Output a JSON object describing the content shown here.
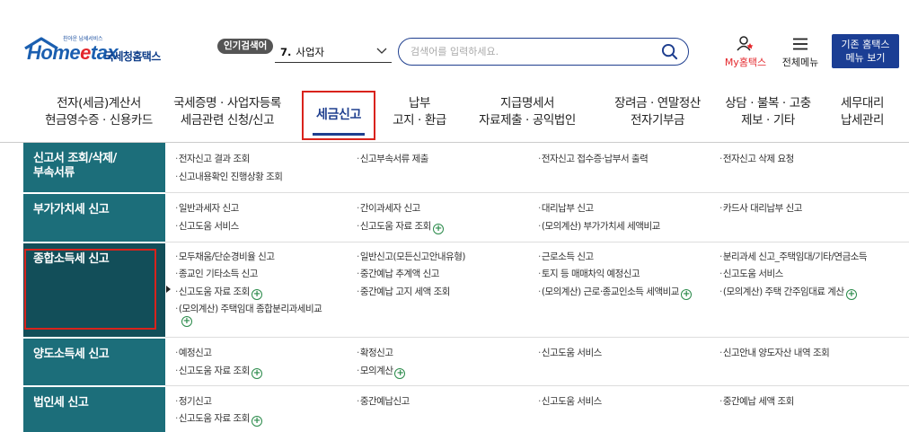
{
  "logo": {
    "tagline": "친아운 납세서비스",
    "home": "Home",
    "tax": "tax",
    "nts_name": "국세청홈택스"
  },
  "popular_search": {
    "badge": "인기검색어",
    "rank": "7.",
    "term": "사업자"
  },
  "search": {
    "placeholder": "검색어를 입력하세요.",
    "value": ""
  },
  "utility": {
    "my_hometax": "My홈택스",
    "all_menu": "전체메뉴",
    "old_menu_line1": "기존 홈택스",
    "old_menu_line2": "메뉴 보기"
  },
  "gnb": [
    {
      "l1": "전자(세금)계산서",
      "l2": "현금영수증 · 신용카드"
    },
    {
      "l1": "국세증명 · 사업자등록",
      "l2": "세금관련 신청/신고"
    },
    {
      "l1": "세금신고",
      "l2": ""
    },
    {
      "l1": "납부",
      "l2": "고지 · 환급"
    },
    {
      "l1": "지급명세서",
      "l2": "자료제출 · 공익법인"
    },
    {
      "l1": "장려금 · 연말정산",
      "l2": "전자기부금"
    },
    {
      "l1": "상담 · 불복 · 고충",
      "l2": "제보 · 기타"
    },
    {
      "l1": "세무대리",
      "l2": "납세관리"
    }
  ],
  "categories": {
    "c0": {
      "line1": "신고서 조회/삭제/",
      "line2": "부속서류"
    },
    "c1": "부가가치세 신고",
    "c2": "종합소득세 신고",
    "c3": "양도소득세 신고",
    "c4": "법인세 신고"
  },
  "items": {
    "r0": [
      "전자신고 결과 조회",
      "신고부속서류 제출",
      "전자신고 접수증·납부서 출력",
      "전자신고 삭제 요청",
      "신고내용확인 진행상황 조회"
    ],
    "r1": [
      "일반과세자 신고",
      "간이과세자 신고",
      "대리납부 신고",
      "카드사 대리납부 신고",
      "신고도움 서비스",
      "신고도움 자료 조회",
      "(모의계산) 부가가치세 세액비교"
    ],
    "r2": [
      "모두채움/단순경비율 신고",
      "일반신고(모든신고안내유형)",
      "근로소득 신고",
      "분리과세 신고_주택임대/기타/연금소득",
      "종교인 기타소득 신고",
      "중간예납 추계액 신고",
      "토지 등 매매차익 예정신고",
      "신고도움 서비스",
      "신고도움 자료 조회",
      "중간예납 고지 세액 조회",
      "(모의계산) 근로·종교인소득 세액비교",
      "(모의계산) 주택 간주임대료 계산",
      "(모의계산) 주택임대 종합분리과세비교"
    ],
    "r3": [
      "예정신고",
      "확정신고",
      "신고도움 서비스",
      "신고안내 양도자산 내역 조회",
      "신고도움 자료 조회",
      "모의계산"
    ],
    "r4": [
      "정기신고",
      "중간예납신고",
      "신고도움 서비스",
      "중간예납 세액 조회",
      "신고도움 자료 조회"
    ]
  },
  "plus_symbol": "+"
}
